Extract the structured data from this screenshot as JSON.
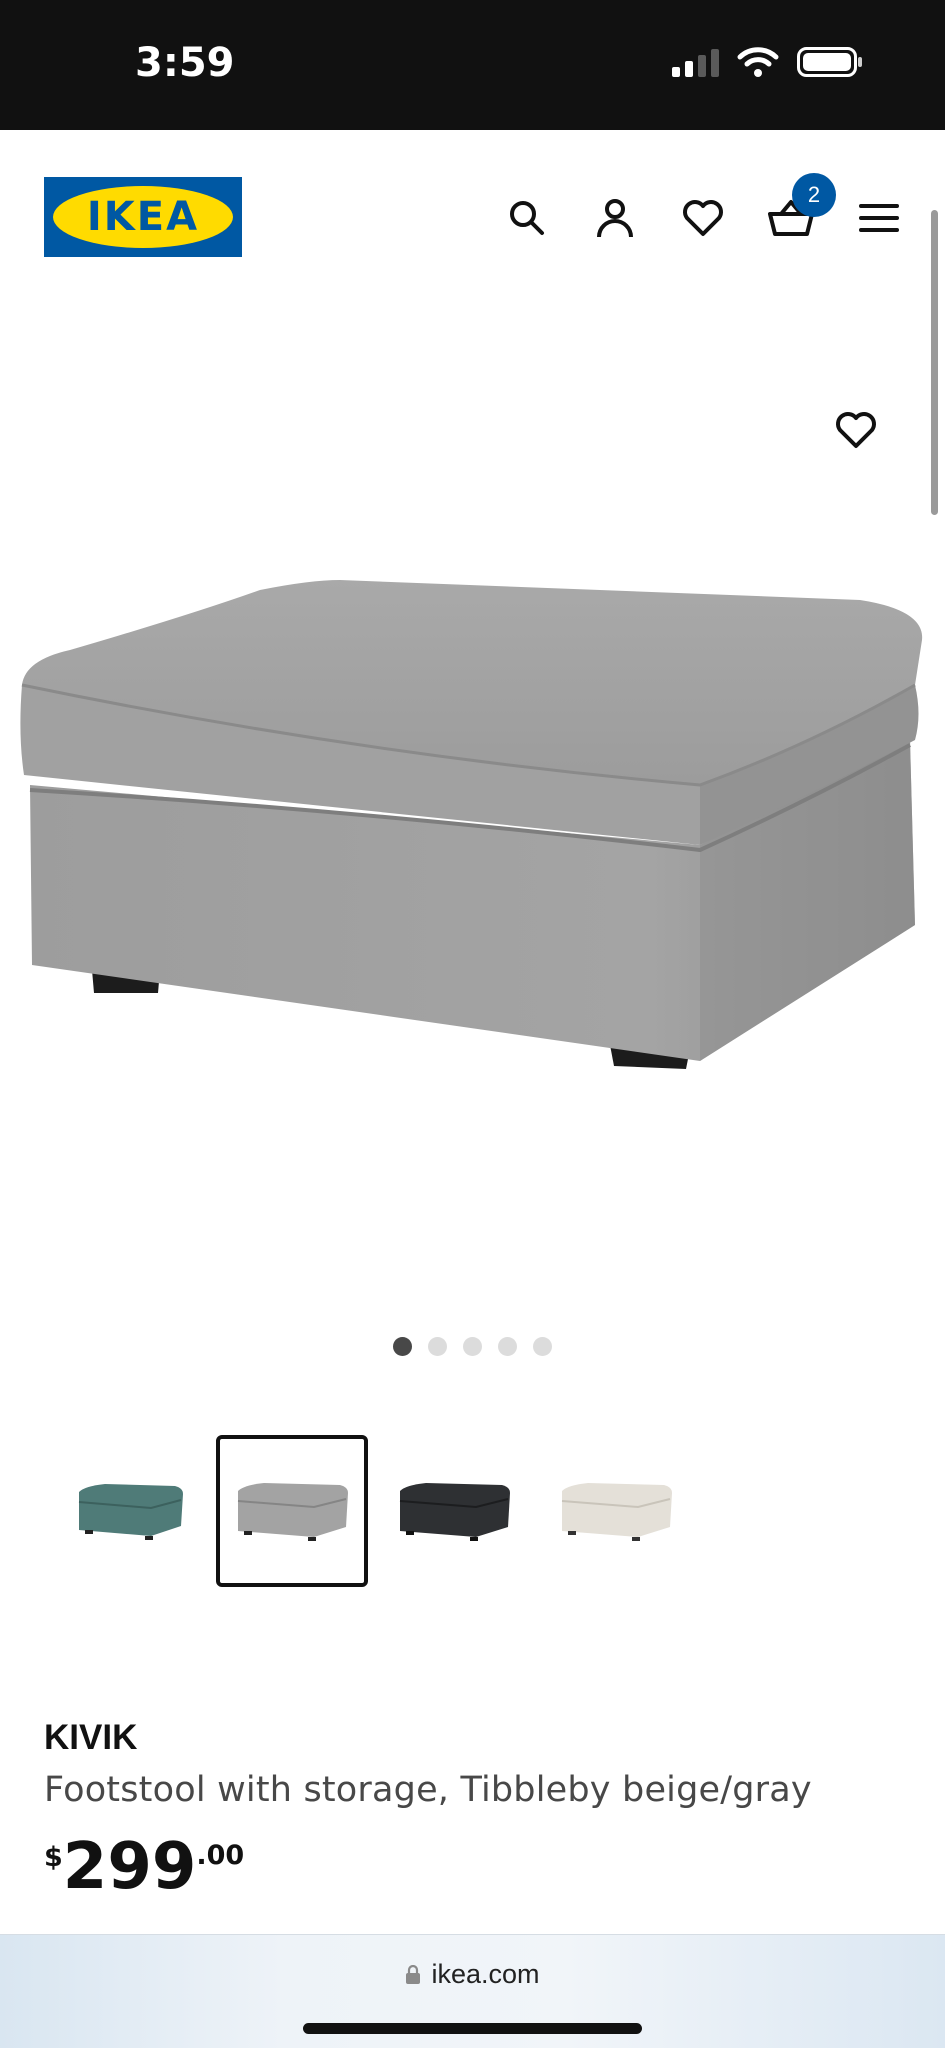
{
  "status_bar": {
    "time": "3:59",
    "battery_icon": "battery-icon",
    "wifi_icon": "wifi-icon",
    "signal_icon": "signal-icon"
  },
  "header": {
    "logo_text": "IKEA",
    "icons": [
      "search-icon",
      "account-icon",
      "heart-icon",
      "cart-icon",
      "menu-icon"
    ],
    "cart_count": "2",
    "brand_blue": "#0058a3",
    "brand_yellow": "#ffdb00"
  },
  "gallery": {
    "favorite_icon": "heart-icon",
    "image_count": 5,
    "active_index": 0
  },
  "variants": [
    {
      "color": "#4f7b78",
      "selected": false
    },
    {
      "color": "#a3a3a3",
      "selected": true
    },
    {
      "color": "#2e3033",
      "selected": false
    },
    {
      "color": "#e4e0d8",
      "selected": false
    }
  ],
  "product": {
    "name": "KIVIK",
    "description": "Footstool with storage, Tibbleby beige/gray",
    "price_currency": "$",
    "price_integer": "299",
    "price_decimal": ".00"
  },
  "browser": {
    "url": "ikea.com",
    "lock_icon": "lock-icon"
  }
}
